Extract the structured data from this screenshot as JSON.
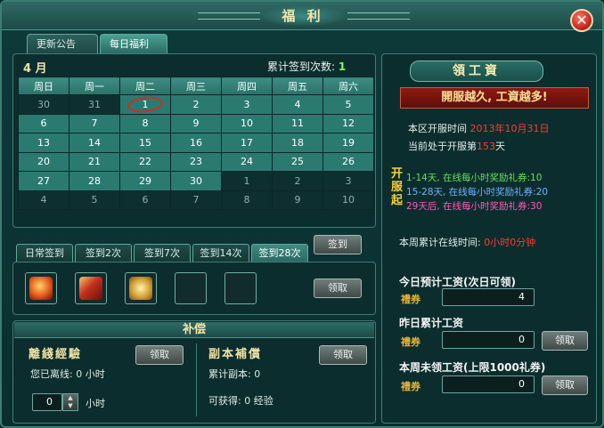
{
  "window": {
    "title": "福 利",
    "close_symbol": "✕"
  },
  "top_tabs": [
    {
      "label": "更新公告",
      "active": false
    },
    {
      "label": "每日福利",
      "active": true
    }
  ],
  "calendar": {
    "month_label": "4 月",
    "count_label": "累计签到次数:",
    "count_value": "1",
    "weekdays": [
      "周日",
      "周一",
      "周二",
      "周三",
      "周四",
      "周五",
      "周六"
    ],
    "weeks": [
      [
        {
          "d": "30",
          "c": false
        },
        {
          "d": "31",
          "c": false
        },
        {
          "d": "1",
          "c": true,
          "today": true
        },
        {
          "d": "2",
          "c": true
        },
        {
          "d": "3",
          "c": true
        },
        {
          "d": "4",
          "c": true
        },
        {
          "d": "5",
          "c": true
        }
      ],
      [
        {
          "d": "6",
          "c": true
        },
        {
          "d": "7",
          "c": true
        },
        {
          "d": "8",
          "c": true
        },
        {
          "d": "9",
          "c": true
        },
        {
          "d": "10",
          "c": true
        },
        {
          "d": "11",
          "c": true
        },
        {
          "d": "12",
          "c": true
        }
      ],
      [
        {
          "d": "13",
          "c": true
        },
        {
          "d": "14",
          "c": true
        },
        {
          "d": "15",
          "c": true
        },
        {
          "d": "16",
          "c": true
        },
        {
          "d": "17",
          "c": true
        },
        {
          "d": "18",
          "c": true
        },
        {
          "d": "19",
          "c": true
        }
      ],
      [
        {
          "d": "20",
          "c": true
        },
        {
          "d": "21",
          "c": true
        },
        {
          "d": "22",
          "c": true
        },
        {
          "d": "23",
          "c": true
        },
        {
          "d": "24",
          "c": true
        },
        {
          "d": "25",
          "c": true
        },
        {
          "d": "26",
          "c": true
        }
      ],
      [
        {
          "d": "27",
          "c": true
        },
        {
          "d": "28",
          "c": true
        },
        {
          "d": "29",
          "c": true
        },
        {
          "d": "30",
          "c": true
        },
        {
          "d": "1",
          "c": false
        },
        {
          "d": "2",
          "c": false
        },
        {
          "d": "3",
          "c": false
        }
      ],
      [
        {
          "d": "4",
          "c": false
        },
        {
          "d": "5",
          "c": false
        },
        {
          "d": "6",
          "c": false
        },
        {
          "d": "7",
          "c": false
        },
        {
          "d": "8",
          "c": false
        },
        {
          "d": "9",
          "c": false
        },
        {
          "d": "10",
          "c": false
        }
      ]
    ]
  },
  "sign_tabs": [
    {
      "label": "日常签到",
      "active": false
    },
    {
      "label": "签到2次",
      "active": false
    },
    {
      "label": "签到7次",
      "active": false
    },
    {
      "label": "签到14次",
      "active": false
    },
    {
      "label": "签到28次",
      "active": true
    }
  ],
  "sign_button": "签到",
  "claim_button": "领取",
  "reward_slots": [
    {
      "icon": "fire-orb-icon",
      "filled": true
    },
    {
      "icon": "red-scroll-icon",
      "filled": true
    },
    {
      "icon": "gold-token-icon",
      "filled": true
    },
    {
      "icon": "empty-slot",
      "filled": false
    },
    {
      "icon": "empty-slot",
      "filled": false
    }
  ],
  "compensation": {
    "header": "补偿",
    "offline": {
      "title": "離綫經驗",
      "claim": "领取",
      "offline_label": "您已离线:",
      "offline_value": "0",
      "offline_unit": "小时",
      "hours_input": "0",
      "hours_unit": "小时"
    },
    "dungeon": {
      "title": "副本補償",
      "claim": "领取",
      "count_label": "累计副本:",
      "count_value": "0",
      "exp_label": "可获得:",
      "exp_value": "0",
      "exp_unit": "经验"
    }
  },
  "wage": {
    "title": "領工資",
    "slogan": "開服越久, 工資越多!",
    "open_time_label": "本区开服时间",
    "open_time_value": "2013年10月31日",
    "day_prefix": "当前处于开服第",
    "day_value": "153",
    "day_suffix": "天",
    "side_label": [
      "开",
      "服",
      "起"
    ],
    "tiers": [
      {
        "text": "1-14天, 在线每小时奖励礼券:10",
        "color": "#65e05a"
      },
      {
        "text": "15-28天, 在线每小时奖励礼券:20",
        "color": "#6eb2ff"
      },
      {
        "text": "29天后, 在线每小时奖励礼券:30",
        "color": "#ff5ab8"
      }
    ],
    "online_label": "本周累计在线时间:",
    "online_value": "0小时0分钟",
    "today_label": "今日预计工资(次日可领)",
    "today_unit": "禮券",
    "today_value": "4",
    "yesterday_label": "昨日累计工资",
    "yesterday_unit": "禮券",
    "yesterday_value": "0",
    "yesterday_claim": "领取",
    "week_label": "本周未领工资(上限1000礼券)",
    "week_unit": "禮券",
    "week_value": "0",
    "week_claim": "领取"
  }
}
